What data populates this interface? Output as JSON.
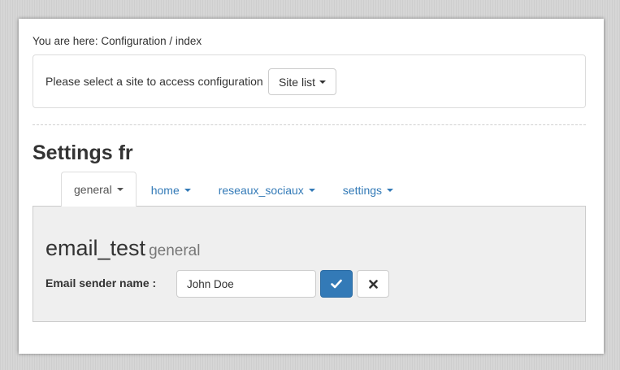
{
  "breadcrumb": {
    "text": "You are here: Configuration / index"
  },
  "site_selector": {
    "label": "Please select a site to access configuration",
    "button_label": "Site list",
    "button_icon": "caret-down-icon"
  },
  "page_title": "Settings fr",
  "tabs": [
    {
      "label": "general",
      "active": true
    },
    {
      "label": "home",
      "active": false
    },
    {
      "label": "reseaux_sociaux",
      "active": false
    },
    {
      "label": "settings",
      "active": false
    }
  ],
  "section": {
    "title": "email_test",
    "subtitle": "general"
  },
  "form": {
    "field_label": "Email sender name :",
    "field_value": "John Doe",
    "confirm_icon": "check-icon",
    "cancel_icon": "close-icon"
  },
  "colors": {
    "link": "#337ab7",
    "primary_button": "#337ab7",
    "content_background": "#efefef"
  }
}
